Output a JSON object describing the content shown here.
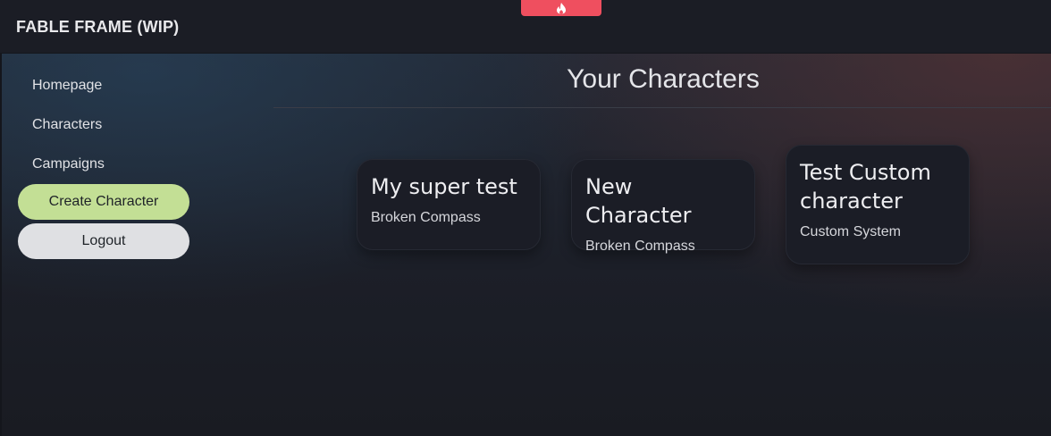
{
  "app": {
    "title": "FABLE FRAME (WIP)"
  },
  "top_tab": {
    "icon": "flame-icon",
    "color": "#ef4f5f"
  },
  "sidebar": {
    "items": [
      {
        "label": "Homepage"
      },
      {
        "label": "Characters"
      },
      {
        "label": "Campaigns"
      }
    ],
    "create_label": "Create Character",
    "logout_label": "Logout"
  },
  "main": {
    "title": "Your Characters",
    "characters": [
      {
        "name": "My super test",
        "system": "Broken Compass"
      },
      {
        "name": "New Character",
        "system": "Broken Compass"
      },
      {
        "name": "Test Custom character",
        "system": "Custom System"
      }
    ]
  },
  "colors": {
    "create_button": "#c3df95",
    "logout_button": "#dfe0e3",
    "card_background": "#1b1d26"
  }
}
